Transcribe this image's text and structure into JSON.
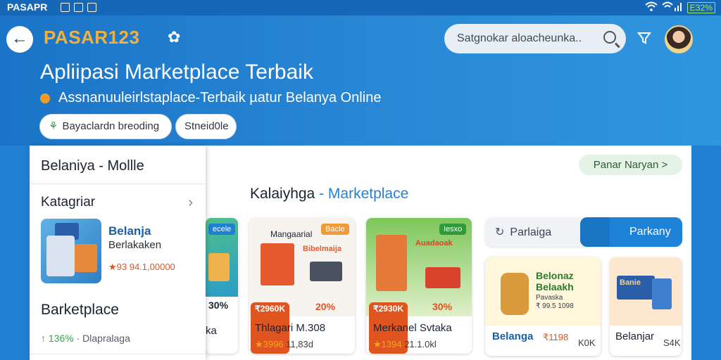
{
  "status_bar": {
    "app_name": "PASAPR",
    "battery": "ЕЗ2%"
  },
  "header": {
    "logo": "PASAR123",
    "search_placeholder": "Satgnokar aloacheunka..",
    "title": "Apliipasi Marketplace Terbaik",
    "subtitle": "Assnanuuleirlstaplace-Terbaik µatur Belanya Online",
    "chips": [
      "Bayaclardn breoding",
      "Stneid0le"
    ]
  },
  "sidebar": {
    "top_label": "Belaniya - Mollle",
    "category_label": "Katagriar",
    "featured": {
      "name": "Belanja",
      "subtitle": "Berlakaken",
      "price": "★93 94.1,00000"
    },
    "marketplace_label": "Barketplace",
    "stat_value": "↑ 136%",
    "stat_label": "· Dlapralaga"
  },
  "main": {
    "section_title": "Kalaiyhga",
    "section_title_accent": "- Marketplace",
    "see_all": "Panar Naryan >",
    "segment": {
      "left": "Parlaiga",
      "right": "Parkany"
    }
  },
  "products": [
    {
      "badge": "ecele",
      "sale": "30%",
      "name": "ka",
      "rating": "",
      "price": ""
    },
    {
      "badge": "Bacle",
      "title_on_image": "Mangaarial",
      "image_text": "Bibelmaija",
      "sale": "₹2960K",
      "discount": "20%",
      "name": "Thlagari M.308",
      "rating": "★3996",
      "price": "11,83d"
    },
    {
      "badge": "Iesxo",
      "image_text": "Auadaoak",
      "sale": "₹2930K",
      "discount": "30%",
      "name": "Merkanel Svtaka",
      "rating": "★1394",
      "price": "21.1.0kl"
    },
    {
      "image_text": "Belonaz Belaakh",
      "image_sub": "Pavaska",
      "image_price": "₹ 99.5 1098",
      "name": "Belanga",
      "price": "₹1198",
      "extra": "K0K"
    },
    {
      "image_text": "Banie",
      "name": "Belanjar",
      "extra": "S4K"
    }
  ],
  "colors": {
    "accent": "#2580d3",
    "header_bg": "#1f7fd0",
    "sale": "#e0541f"
  }
}
